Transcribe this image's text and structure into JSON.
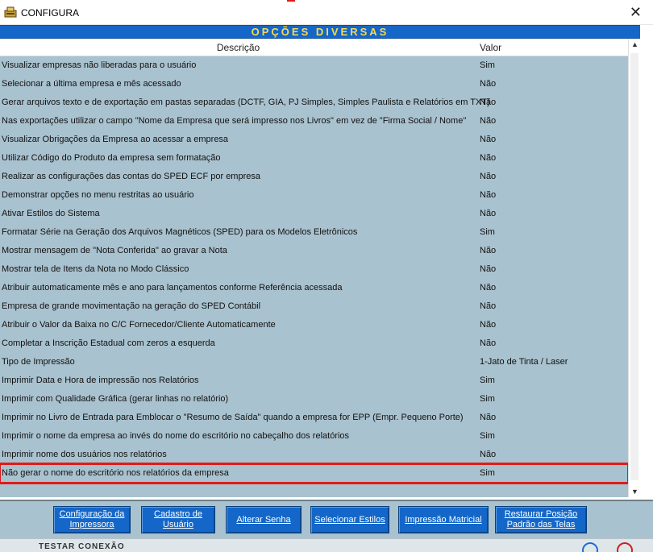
{
  "window": {
    "title": "CONFIGURA",
    "close_label": "✕"
  },
  "banner": {
    "title": "OPÇÕES DIVERSAS"
  },
  "columns": {
    "description": "Descrição",
    "value": "Valor"
  },
  "rows": [
    {
      "desc": "Visualizar empresas não liberadas para o usuário",
      "value": "Sim"
    },
    {
      "desc": "Selecionar a última empresa e mês acessado",
      "value": "Não"
    },
    {
      "desc": "Gerar arquivos texto e de exportação em pastas separadas (DCTF, GIA, PJ Simples, Simples Paulista e Relatórios em TXT)",
      "value": "Não"
    },
    {
      "desc": "Nas exportações utilizar o campo \"Nome da Empresa que será impresso nos Livros\" em vez de \"Firma Social / Nome\"",
      "value": "Não"
    },
    {
      "desc": "Visualizar Obrigações da Empresa ao acessar a empresa",
      "value": "Não"
    },
    {
      "desc": "Utilizar Código do Produto da empresa sem formatação",
      "value": "Não"
    },
    {
      "desc": "Realizar as configurações das contas do SPED ECF por empresa",
      "value": "Não"
    },
    {
      "desc": "Demonstrar opções no menu restritas ao usuário",
      "value": "Não"
    },
    {
      "desc": "Ativar Estilos do Sistema",
      "value": "Não"
    },
    {
      "desc": "Formatar Série na Geração dos Arquivos Magnéticos (SPED) para os Modelos Eletrônicos",
      "value": "Sim"
    },
    {
      "desc": "Mostrar mensagem de \"Nota Conferida\" ao gravar a Nota",
      "value": "Não"
    },
    {
      "desc": "Mostrar tela de Itens da Nota no Modo Clássico",
      "value": "Não"
    },
    {
      "desc": "Atribuir automaticamente mês e ano para lançamentos conforme Referência acessada",
      "value": "Não"
    },
    {
      "desc": "Empresa de grande movimentação na geração do SPED Contábil",
      "value": "Não"
    },
    {
      "desc": "Atribuir o Valor da Baixa no C/C Fornecedor/Cliente Automaticamente",
      "value": "Não"
    },
    {
      "desc": "Completar a Inscrição Estadual com zeros a esquerda",
      "value": "Não"
    },
    {
      "desc": "Tipo de Impressão",
      "value": "1-Jato de Tinta / Laser"
    },
    {
      "desc": "Imprimir Data e Hora de impressão nos Relatórios",
      "value": "Sim"
    },
    {
      "desc": "Imprimir com Qualidade Gráfica (gerar linhas no relatório)",
      "value": "Sim"
    },
    {
      "desc": "Imprimir no Livro de Entrada para Emblocar o \"Resumo de Saída\" quando a empresa for EPP (Empr. Pequeno Porte)",
      "value": "Não"
    },
    {
      "desc": "Imprimir o nome da empresa ao invés do nome do escritório no cabeçalho dos relatórios",
      "value": "Sim"
    },
    {
      "desc": "Imprimir nome dos usuários nos relatórios",
      "value": "Não"
    },
    {
      "desc": "Não gerar o nome do escritório nos relatórios da empresa",
      "value": "Sim",
      "highlighted": true
    }
  ],
  "buttons": [
    {
      "line1": "Configuração da",
      "line2": "Impressora"
    },
    {
      "line1": "Cadastro de",
      "line2": "Usuário"
    },
    {
      "line1": "Alterar Senha",
      "line2": ""
    },
    {
      "line1": "Selecionar Estilos",
      "line2": ""
    },
    {
      "line1": "Impressão Matricial",
      "line2": ""
    },
    {
      "line1": "Restaurar Posição",
      "line2": "Padrão das Telas"
    }
  ],
  "footer": {
    "connection_label": "TESTAR CONEXÃO"
  },
  "colors": {
    "panel_bg": "#a9c2cf",
    "banner_bg": "#1467c8",
    "banner_text": "#ffd84a",
    "button_bg": "#1467c8",
    "highlight": "#e01a1a"
  }
}
